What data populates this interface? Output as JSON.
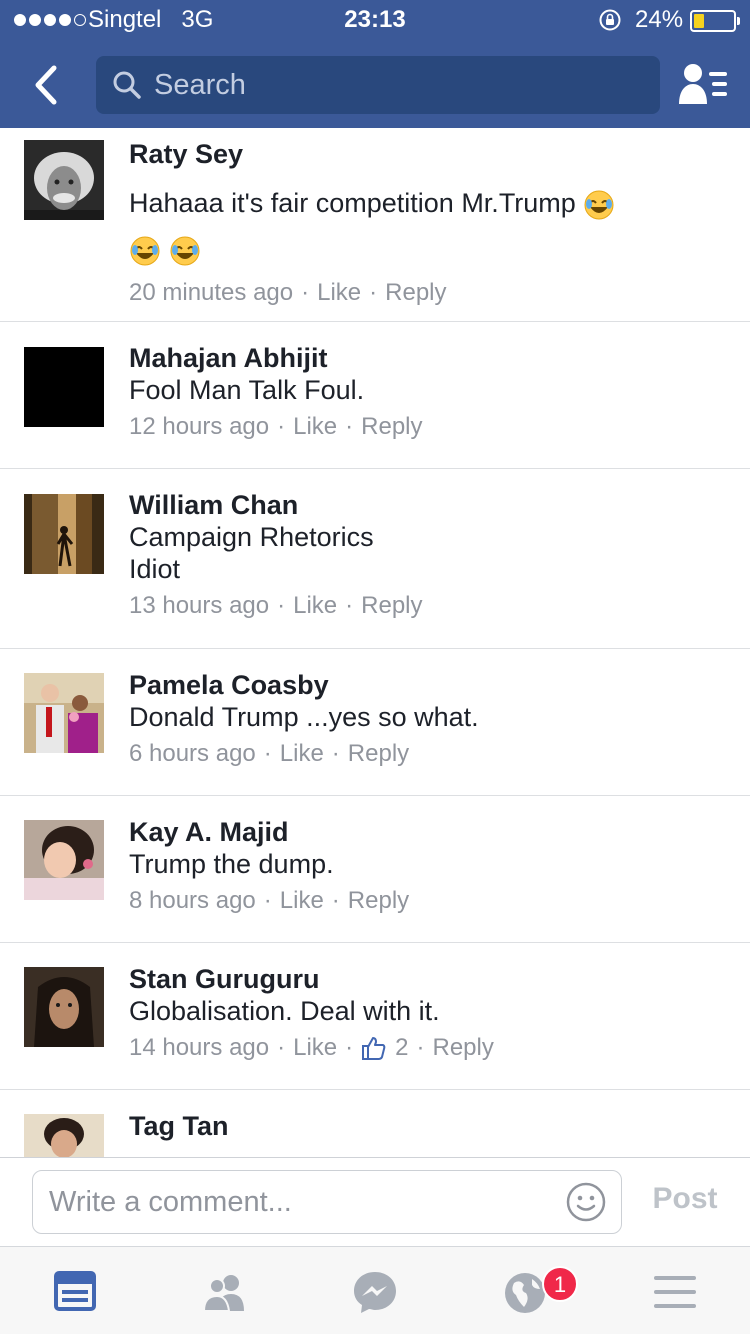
{
  "status_bar": {
    "carrier": "Singtel",
    "network": "3G",
    "time": "23:13",
    "battery": "24%",
    "signal_bars": 4
  },
  "header": {
    "back_icon": "chevron-left-icon",
    "search_placeholder": "Search",
    "friends_icon": "friends-list-icon"
  },
  "comments": [
    {
      "name": "Raty Sey",
      "text": "Hahaaa it's fair competition Mr.Trump",
      "trailing_emoji_count": 3,
      "time": "20 minutes ago",
      "like": "Like",
      "reply": "Reply",
      "avatar": "portrait-grey-hair"
    },
    {
      "name": "Mahajan Abhijit",
      "text": "Fool Man Talk Foul.",
      "time": "12 hours ago",
      "like": "Like",
      "reply": "Reply",
      "avatar": "black-square"
    },
    {
      "name": "William Chan",
      "text": "Campaign Rhetorics\nIdiot",
      "time": "13 hours ago",
      "like": "Like",
      "reply": "Reply",
      "avatar": "dim-figure"
    },
    {
      "name": "Pamela Coasby",
      "text": "Donald Trump ...yes so what.",
      "time": "6 hours ago",
      "like": "Like",
      "reply": "Reply",
      "avatar": "couple-photo"
    },
    {
      "name": "Kay A. Majid",
      "text": "Trump the dump.",
      "time": "8 hours ago",
      "like": "Like",
      "reply": "Reply",
      "avatar": "child-photo"
    },
    {
      "name": "Stan Guruguru",
      "text": "Globalisation. Deal with it.",
      "time": "14 hours ago",
      "like": "Like",
      "like_count": "2",
      "reply": "Reply",
      "avatar": "long-hair-man"
    },
    {
      "name": "Tag Tan",
      "avatar": "woman-photo"
    }
  ],
  "composer": {
    "placeholder": "Write a comment...",
    "post_label": "Post",
    "emoji_icon": "smiley-icon"
  },
  "tabbar": {
    "items": [
      "news-feed-icon",
      "friends-icon",
      "messenger-icon",
      "notifications-globe-icon",
      "menu-icon"
    ],
    "notification_badge": "1"
  },
  "colors": {
    "brand_blue": "#3b5998",
    "search_bg": "#29487d",
    "active_tab": "#4267b2",
    "inactive_tab": "#a8aeb7",
    "meta_gray": "#90949c",
    "badge_red": "#f02849"
  }
}
